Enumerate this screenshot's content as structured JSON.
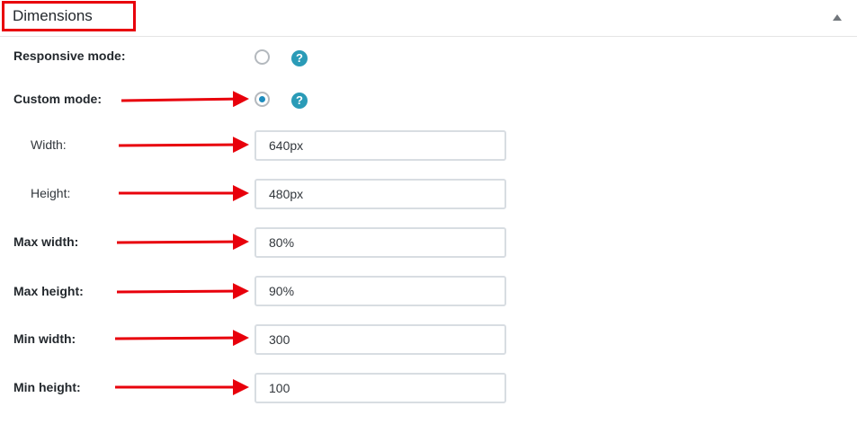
{
  "panel": {
    "title": "Dimensions",
    "toggle_icon": "triangle-up-icon"
  },
  "rows": {
    "responsive_mode": {
      "label": "Responsive mode:",
      "selected": false
    },
    "custom_mode": {
      "label": "Custom mode:",
      "selected": true
    },
    "width": {
      "label": "Width:",
      "value": "640px"
    },
    "height": {
      "label": "Height:",
      "value": "480px"
    },
    "max_width": {
      "label": "Max width:",
      "value": "80%"
    },
    "max_height": {
      "label": "Max height:",
      "value": "90%"
    },
    "min_width": {
      "label": "Min width:",
      "value": "300"
    },
    "min_height": {
      "label": "Min height:",
      "value": "100"
    }
  },
  "help_icon": {
    "glyph": "?"
  },
  "colors": {
    "annotation_red": "#e8000b",
    "help_teal": "#2a9bb7",
    "radio_selected": "#1e8cbe"
  }
}
